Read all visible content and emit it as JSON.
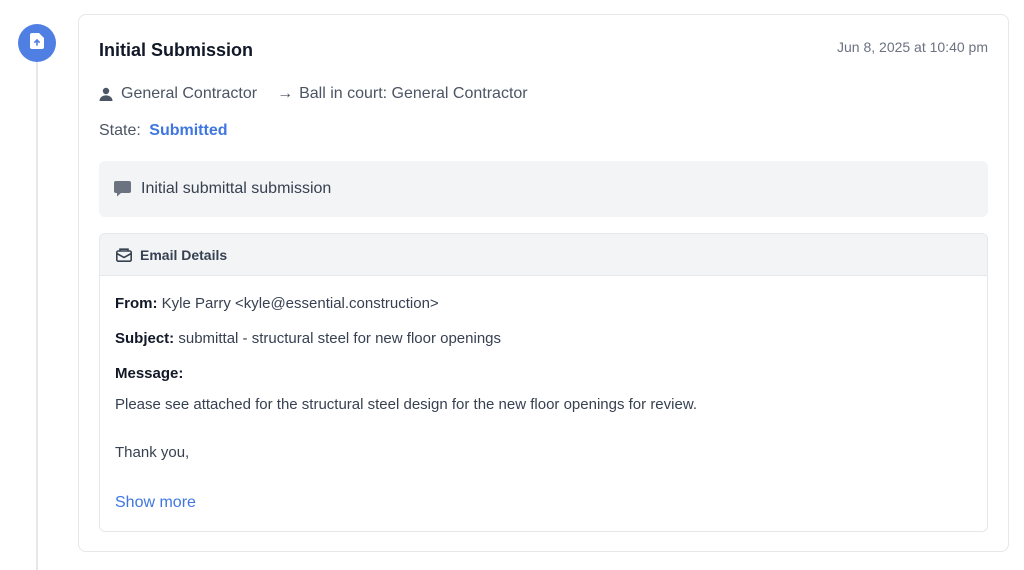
{
  "event": {
    "title": "Initial Submission",
    "timestamp": "Jun 8, 2025 at 10:40 pm",
    "actor": "General Contractor",
    "ball_in_court": "Ball in court: General Contractor",
    "state_label": "State:",
    "state_value": "Submitted",
    "comment": "Initial submittal submission"
  },
  "email": {
    "header": "Email Details",
    "from_label": "From:",
    "from_value": "Kyle Parry <kyle@essential.construction>",
    "subject_label": "Subject:",
    "subject_value": "submittal - structural steel for new floor openings",
    "message_label": "Message:",
    "message_line1": "Please see attached for the structural steel design for the new floor openings for review.",
    "message_line2": "Thank you,",
    "show_more": "Show more"
  },
  "colors": {
    "accent": "#4f7fe3",
    "state": "#3f76e0"
  },
  "icons": {
    "timeline": "document-upload-icon",
    "actor": "user-icon",
    "arrow": "arrow-right-icon",
    "comment": "comment-icon",
    "email": "envelope-icon"
  }
}
